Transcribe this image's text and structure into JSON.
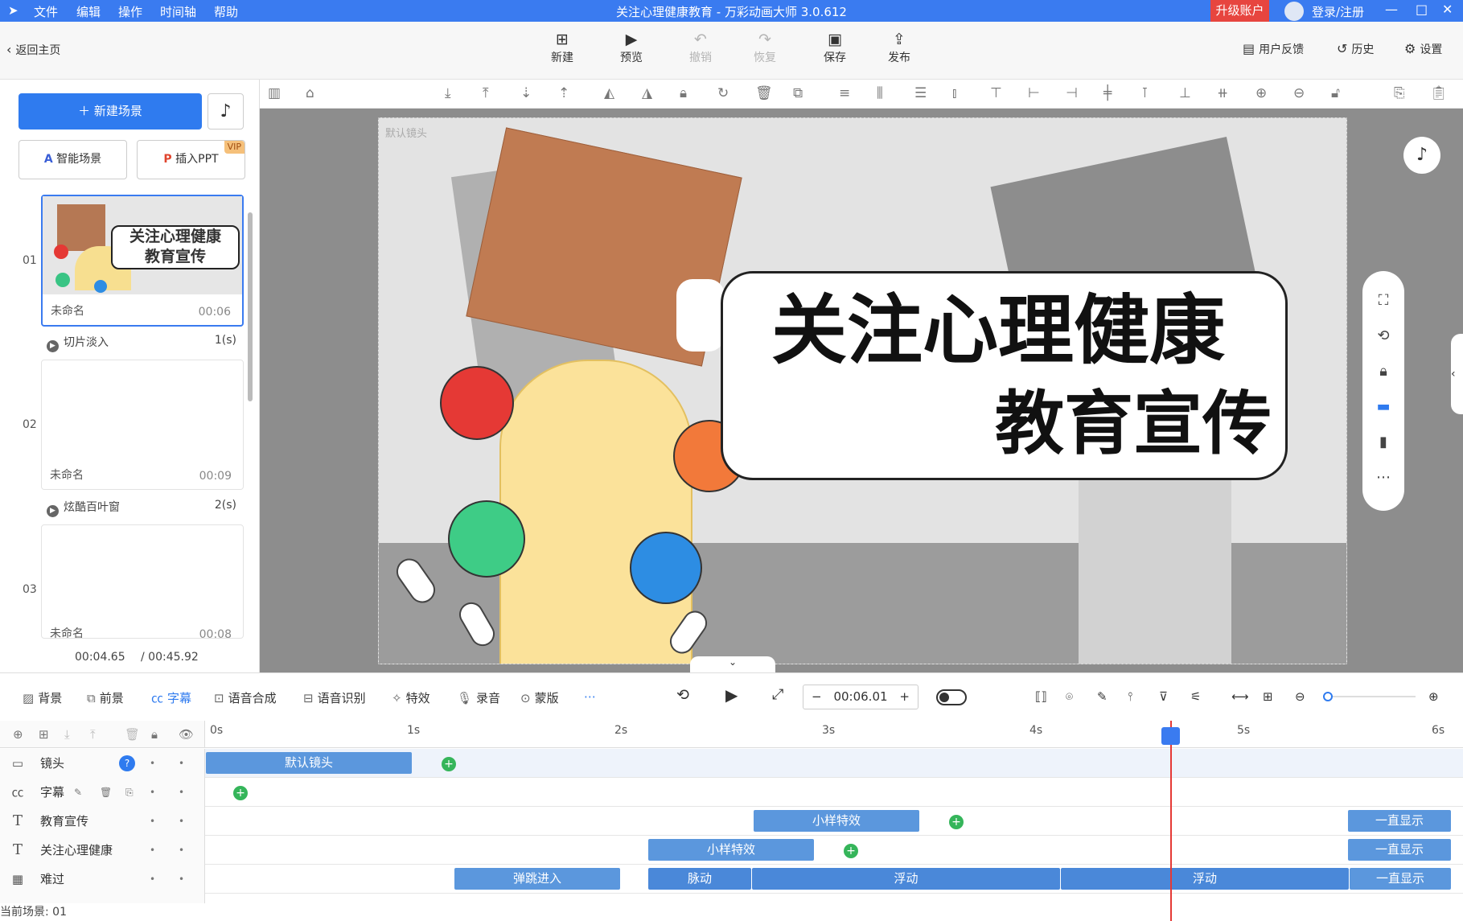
{
  "menu": {
    "items": [
      "文件",
      "编辑",
      "操作",
      "时间轴",
      "帮助"
    ]
  },
  "window": {
    "title": "关注心理健康教育 - 万彩动画大师 3.0.612",
    "upgrade": "升级账户",
    "login": "登录/注册"
  },
  "toolbar": {
    "back": "返回主页",
    "buttons": [
      "新建",
      "预览",
      "撤销",
      "恢复",
      "保存",
      "发布"
    ],
    "feedback": "用户反馈",
    "history": "历史",
    "settings": "设置"
  },
  "left": {
    "new_scene": "新建场景",
    "smart_scene": "智能场景",
    "insert_ppt": "插入PPT",
    "vip": "VIP",
    "scenes": [
      {
        "num": "01",
        "name": "未命名",
        "duration": "00:06",
        "thumb_line1": "关注心理健康",
        "thumb_line2": "教育宣传"
      },
      {
        "num": "02",
        "name": "未命名",
        "duration": "00:09"
      },
      {
        "num": "03",
        "name": "未命名",
        "duration": "00:08"
      }
    ],
    "transitions": [
      {
        "name": "切片淡入",
        "count": "1(s)"
      },
      {
        "name": "炫酷百叶窗",
        "count": "2(s)"
      }
    ],
    "time_current": "00:04.65",
    "time_total": "/ 00:45.92"
  },
  "canvas": {
    "camera_label": "默认镜头",
    "headline1": "关注心理健康",
    "headline2": "教育宣传"
  },
  "timeline": {
    "tools": [
      "背景",
      "前景",
      "字幕",
      "语音合成",
      "语音识别",
      "特效",
      "录音",
      "蒙版"
    ],
    "time": "00:06.01",
    "ruler": [
      "0s",
      "1s",
      "2s",
      "3s",
      "4s",
      "5s",
      "6s"
    ],
    "tracks": [
      {
        "name": "镜头",
        "clips": [
          "默认镜头"
        ]
      },
      {
        "name": "字幕",
        "clips": []
      },
      {
        "name": "教育宣传",
        "clips": [
          "小样特效",
          "一直显示"
        ]
      },
      {
        "name": "关注心理健康",
        "clips": [
          "小样特效",
          "一直显示"
        ]
      },
      {
        "name": "难过",
        "clips": [
          "弹跳进入",
          "脉动",
          "浮动",
          "浮动",
          "一直显示"
        ]
      }
    ],
    "status": "当前场景: 01"
  },
  "colors": {
    "accent": "#3a7bf0",
    "upgrade": "#e7453f",
    "keyframe": "#35b55a",
    "clip": "#5b97dd",
    "playhead": "#e53935"
  }
}
